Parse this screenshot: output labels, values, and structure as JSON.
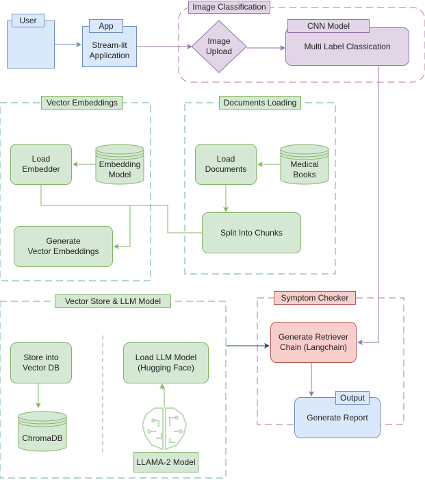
{
  "diagram": {
    "user": {
      "tab_label": "User",
      "icon": "user-icon"
    },
    "app": {
      "tab_label": "App",
      "label": "Stream-lit\nApplication"
    },
    "image_classification": {
      "group_label": "Image Classification",
      "image_upload": "Image\nUpload",
      "cnn_tab_label": "CNN Model",
      "cnn_label": "Multi Label Classication"
    },
    "vector_embeddings": {
      "group_label": "Vector Embeddings",
      "load_embedder": "Load\nEmbedder",
      "embedding_model": "Embedding\nModel",
      "generate_vectors": "Generate\nVector Embeddings"
    },
    "documents_loading": {
      "group_label": "Documents Loading",
      "load_documents": "Load\nDocuments",
      "medical_books": "Medical\nBooks",
      "split_chunks": "Split Into Chunks"
    },
    "vector_store": {
      "group_label": "Vector Store & LLM Model",
      "store_vector_db": "Store into\nVector DB",
      "chromadb": "ChromaDB",
      "load_llm": "Load LLM Model\n(Hugging Face)",
      "llama_label": "LLAMA-2 Model",
      "llama_icon": "brain-circuit-icon"
    },
    "symptom_checker": {
      "group_label": "Symptom Checker",
      "retriever_chain": "Generate Retriever\nChain (Langchain)",
      "output_tab_label": "Output",
      "report_label": "Generate Report"
    },
    "colors": {
      "blue_fill": "#dae8fc",
      "blue_stroke": "#6c8ebf",
      "purple_fill": "#e1d5e7",
      "purple_stroke": "#9673a6",
      "green_fill": "#d5e8d4",
      "green_stroke": "#82b366",
      "red_fill": "#f8cecc",
      "red_stroke": "#b85450",
      "dark_arrow": "#23445d"
    }
  }
}
